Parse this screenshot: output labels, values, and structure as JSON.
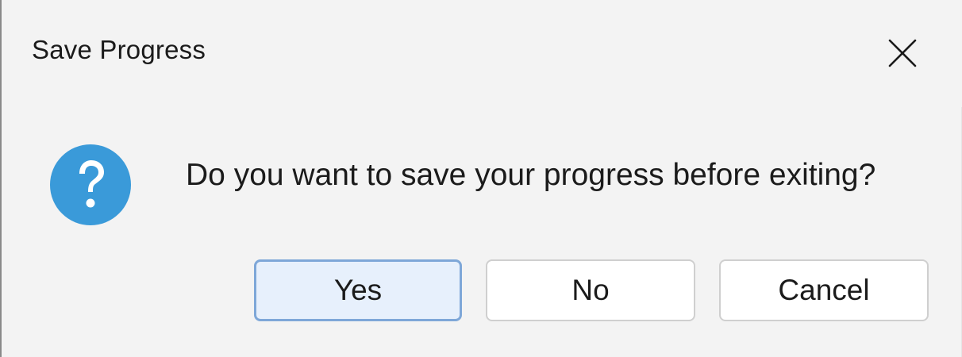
{
  "dialog": {
    "title": "Save Progress",
    "message": "Do you want to save your progress before exiting?",
    "icon": "question-icon",
    "accent_color": "#3a9ad9"
  },
  "buttons": {
    "yes_label": "Yes",
    "no_label": "No",
    "cancel_label": "Cancel",
    "default": "Yes"
  }
}
